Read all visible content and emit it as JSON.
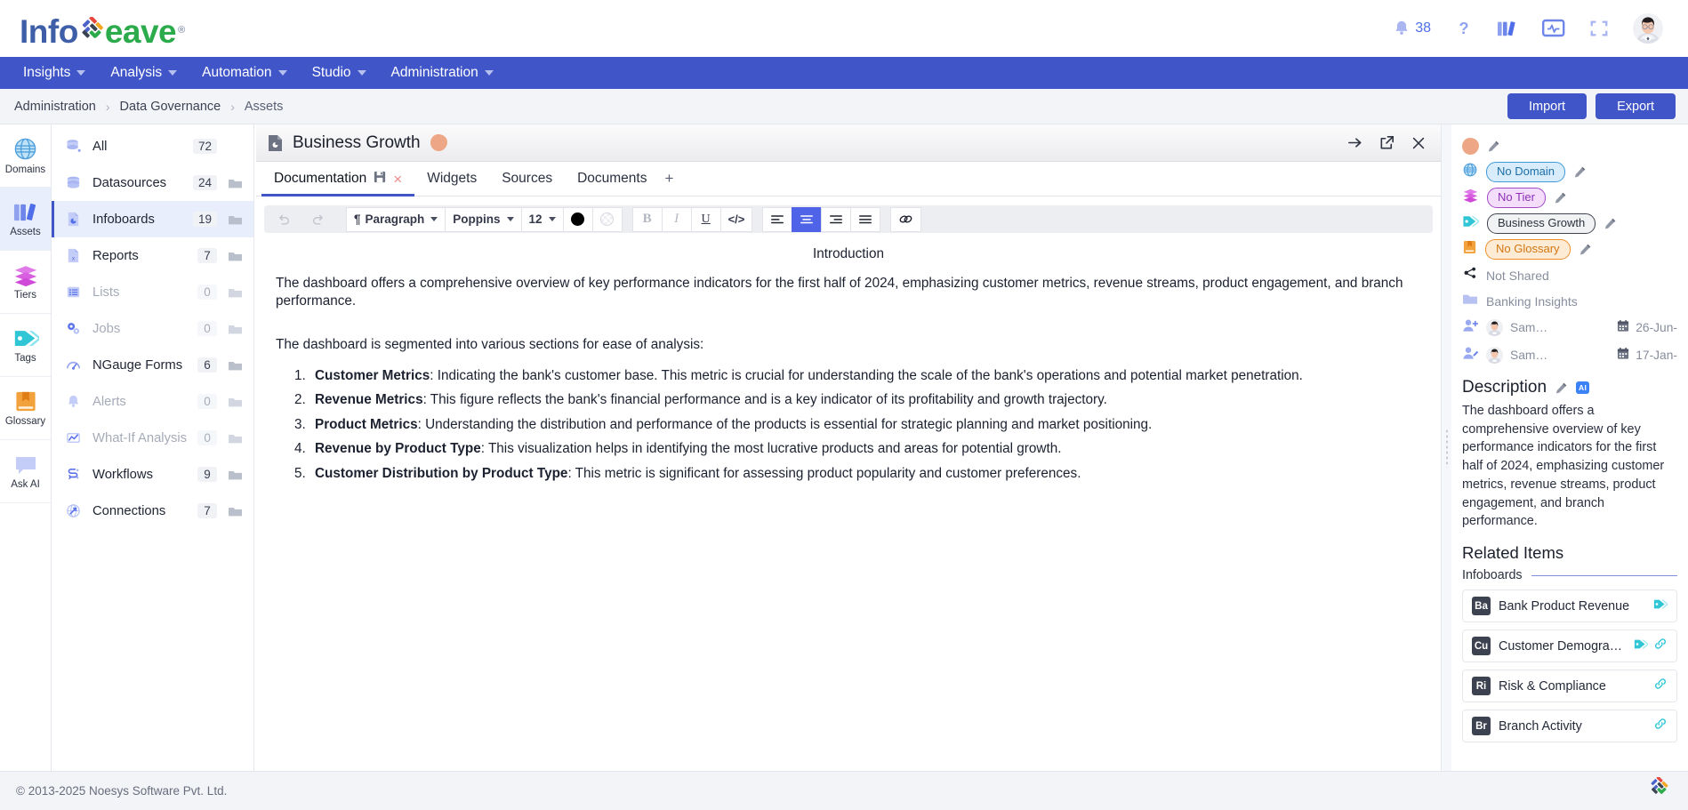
{
  "brand": {
    "name_part1": "Info",
    "name_part2": "eave",
    "registered": "®",
    "color_blue": "#3f5ea8",
    "color_green": "#2cab4c"
  },
  "topbar": {
    "notification_count": "38",
    "icons": [
      "bell-icon",
      "help-icon",
      "library-icon",
      "monitor-icon",
      "fullscreen-icon",
      "avatar"
    ]
  },
  "nav": {
    "items": [
      {
        "label": "Insights",
        "has_caret": true
      },
      {
        "label": "Analysis",
        "has_caret": true
      },
      {
        "label": "Automation",
        "has_caret": true
      },
      {
        "label": "Studio",
        "has_caret": true
      },
      {
        "label": "Administration",
        "has_caret": true
      }
    ]
  },
  "breadcrumb": {
    "items": [
      "Administration",
      "Data Governance",
      "Assets"
    ],
    "separator": "›",
    "import_label": "Import",
    "export_label": "Export"
  },
  "rail": {
    "items": [
      {
        "label": "Domains",
        "icon": "globe-icon",
        "active": false
      },
      {
        "label": "Assets",
        "icon": "books-icon",
        "active": true
      },
      {
        "label": "Tiers",
        "icon": "layers-icon",
        "active": false
      },
      {
        "label": "Tags",
        "icon": "tag-icon",
        "active": false
      },
      {
        "label": "Glossary",
        "icon": "book-icon",
        "active": false
      },
      {
        "label": "Ask AI",
        "icon": "chat-icon",
        "active": false
      }
    ]
  },
  "asset_list": {
    "rows": [
      {
        "label": "All",
        "count": "72",
        "icon": "database-all-icon",
        "active": false,
        "dim": false,
        "folder": false
      },
      {
        "label": "Datasources",
        "count": "24",
        "icon": "database-icon",
        "active": false,
        "dim": false,
        "folder": true
      },
      {
        "label": "Infoboards",
        "count": "19",
        "icon": "infoboard-icon",
        "active": true,
        "dim": false,
        "folder": true
      },
      {
        "label": "Reports",
        "count": "7",
        "icon": "report-icon",
        "active": false,
        "dim": false,
        "folder": true
      },
      {
        "label": "Lists",
        "count": "0",
        "icon": "list-icon",
        "active": false,
        "dim": true,
        "folder": true
      },
      {
        "label": "Jobs",
        "count": "0",
        "icon": "jobs-icon",
        "active": false,
        "dim": true,
        "folder": true
      },
      {
        "label": "NGauge Forms",
        "count": "6",
        "icon": "gauge-icon",
        "active": false,
        "dim": false,
        "folder": true
      },
      {
        "label": "Alerts",
        "count": "0",
        "icon": "alert-bell-icon",
        "active": false,
        "dim": true,
        "folder": true
      },
      {
        "label": "What-If Analysis",
        "count": "0",
        "icon": "chart-line-icon",
        "active": false,
        "dim": true,
        "folder": true
      },
      {
        "label": "Workflows",
        "count": "9",
        "icon": "workflow-icon",
        "active": false,
        "dim": false,
        "folder": true
      },
      {
        "label": "Connections",
        "count": "7",
        "icon": "connections-icon",
        "active": false,
        "dim": false,
        "folder": true
      }
    ]
  },
  "document": {
    "title": "Business Growth",
    "head_icons": [
      "arrow-right-icon",
      "open-external-icon",
      "close-icon"
    ],
    "tabs": [
      {
        "label": "Documentation",
        "active": true,
        "has_save": true,
        "has_close": true
      },
      {
        "label": "Widgets",
        "active": false
      },
      {
        "label": "Sources",
        "active": false
      },
      {
        "label": "Documents",
        "active": false
      }
    ],
    "tab_add": "+",
    "toolbar": {
      "undo": "undo-icon",
      "redo": "redo-icon",
      "block_format": "Paragraph",
      "font_family": "Poppins",
      "font_size": "12",
      "text_color": "#000000",
      "highlight_color": "transparent",
      "bold": "B",
      "italic": "I",
      "underline": "U",
      "code": "</>",
      "align_left": "align-left-icon",
      "align_center": "align-center-icon",
      "align_right": "align-right-icon",
      "align_justify": "align-justify-icon",
      "link": "link-icon",
      "active_alignment": "align-center-icon"
    },
    "content": {
      "heading": "Introduction",
      "intro": "The dashboard offers a comprehensive overview of key performance indicators for the first half of 2024, emphasizing customer metrics, revenue streams, product engagement, and branch performance.",
      "segments_lead": "The dashboard is segmented into various sections for ease of analysis:",
      "list": [
        {
          "term": "Customer Metrics",
          "text": ": Indicating the bank's customer base. This metric is crucial for understanding the scale of the bank's operations and potential market penetration."
        },
        {
          "term": "Revenue Metrics",
          "text": ": This figure reflects the bank's financial performance and is a key indicator of its profitability and growth trajectory."
        },
        {
          "term": "Product Metrics",
          "text": ": Understanding the distribution and performance of the products is essential for strategic planning and market positioning."
        },
        {
          "term": "Revenue by Product Type",
          "text": ": This visualization helps in identifying the most lucrative products and areas for potential growth."
        },
        {
          "term": "Customer Distribution by Product Type",
          "text": ": This metric is significant for assessing product popularity and customer preferences."
        }
      ]
    }
  },
  "right_panel": {
    "meta": [
      {
        "icon": "blob-icon",
        "value": "",
        "editable": true,
        "type": "blob"
      },
      {
        "icon": "globe-icon",
        "value": "No Domain",
        "editable": true,
        "type": "chip",
        "chip_class": "domain"
      },
      {
        "icon": "layers-icon",
        "value": "No Tier",
        "editable": true,
        "type": "chip",
        "chip_class": "tier"
      },
      {
        "icon": "tag-icon",
        "value": "Business Growth",
        "editable": true,
        "type": "chip",
        "chip_class": "tag"
      },
      {
        "icon": "book-icon",
        "value": "No Glossary",
        "editable": true,
        "type": "chip",
        "chip_class": "gloss"
      },
      {
        "icon": "share-icon",
        "value": "Not Shared",
        "editable": false,
        "type": "plain"
      },
      {
        "icon": "folder-icon",
        "value": "Banking Insights",
        "editable": false,
        "type": "plain"
      }
    ],
    "users": [
      {
        "icon": "user-add-icon",
        "name": "Sam…",
        "date": "26-Jun-"
      },
      {
        "icon": "user-edit-icon",
        "name": "Sam…",
        "date": "17-Jan-"
      }
    ],
    "description_title": "Description",
    "description_ai_badge": "AI",
    "description_text": "The dashboard offers a comprehensive overview of key performance indicators for the first half of 2024, emphasizing customer metrics, revenue streams, product engagement, and branch performance.",
    "related_title": "Related Items",
    "related_subtitle": "Infoboards",
    "related_items": [
      {
        "abbr": "Ba",
        "name": "Bank Product Revenue",
        "color": "#3d4250",
        "has_tag": true,
        "has_link": false
      },
      {
        "abbr": "Cu",
        "name": "Customer Demographic",
        "color": "#3d4250",
        "has_tag": true,
        "has_link": true
      },
      {
        "abbr": "Ri",
        "name": "Risk & Compliance",
        "color": "#3d4250",
        "has_tag": false,
        "has_link": true
      },
      {
        "abbr": "Br",
        "name": "Branch Activity",
        "color": "#3d4250",
        "has_tag": false,
        "has_link": true
      }
    ]
  },
  "footer": {
    "copyright": "© 2013-2025 Noesys Software Pvt. Ltd."
  }
}
